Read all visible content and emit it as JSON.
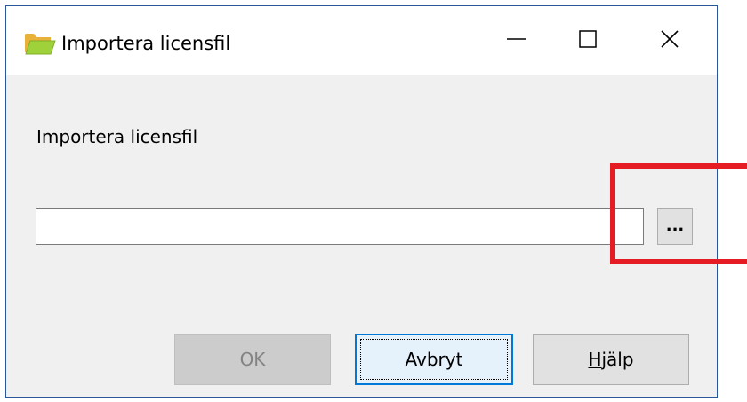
{
  "window": {
    "title": "Importera licensfil",
    "icon": "folder-open-icon",
    "controls": {
      "minimize": "minimize-icon",
      "maximize": "maximize-icon",
      "close": "close-icon"
    }
  },
  "form": {
    "label": "Importera licensfil",
    "path_value": "",
    "browse_label": "..."
  },
  "buttons": {
    "ok_label": "OK",
    "cancel_label": "Avbryt",
    "help_mnemonic": "H",
    "help_rest": "jälp"
  },
  "colors": {
    "highlight": "#e51c23",
    "accent": "#0078d7",
    "dialog_bg": "#f0f0f0"
  }
}
